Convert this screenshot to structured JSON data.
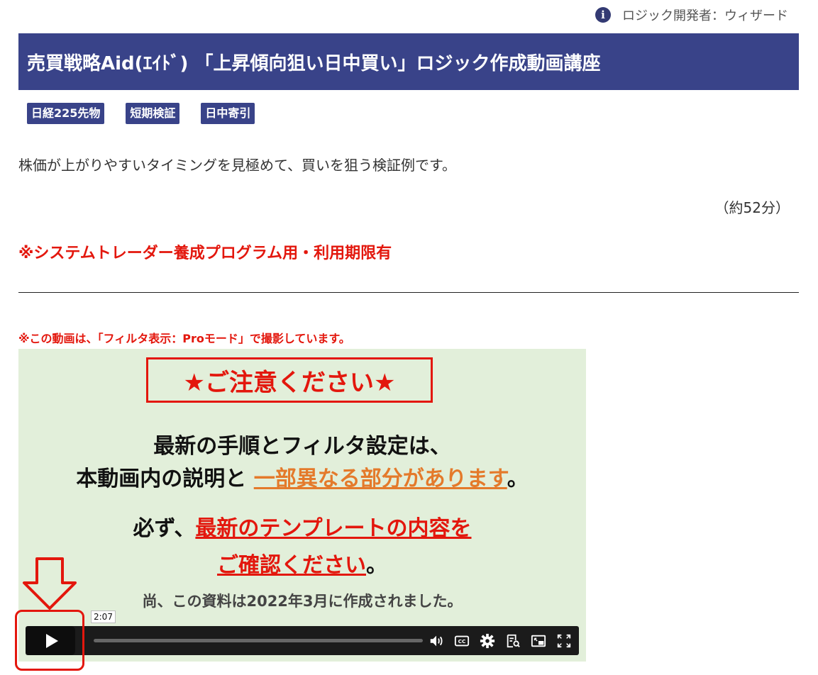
{
  "header": {
    "author_icon": "info-icon",
    "author": "ロジック開発者：ウィザード"
  },
  "title": "売買戦略Aid(ｴｲﾄﾞ) 「上昇傾向狙い日中買い」ロジック作成動画講座",
  "tags": [
    "日経225先物",
    "短期検証",
    "日中寄引"
  ],
  "description": "株価が上がりやすいタイミングを見極めて、買いを狙う検証例です。",
  "duration": "（約52分）",
  "notice": "※システムトレーダー養成プログラム用・利用期限有",
  "filter_note": "※この動画は、「フィルタ表示：Proモード」で撮影しています。",
  "video": {
    "caution": "★ご注意ください★",
    "line1": "最新の手順とフィルタ設定は、",
    "line2_prefix": "本動画内の説明と",
    "line2_highlight": "一部異なる部分があります",
    "line2_suffix": "。",
    "line3_prefix": "必ず、",
    "line3_highlight": "最新のテンプレートの内容を",
    "line4_highlight": "ご確認ください",
    "line4_suffix": "。",
    "line5": "尚、この資料は2022年3月に作成されました。",
    "timecode": "2:07",
    "progress": 0,
    "colors": {
      "background": "#e2efda",
      "red": "#e3170d",
      "orange": "#e47a2b"
    }
  },
  "colors": {
    "primary": "#394389",
    "alert": "#e3170d"
  }
}
